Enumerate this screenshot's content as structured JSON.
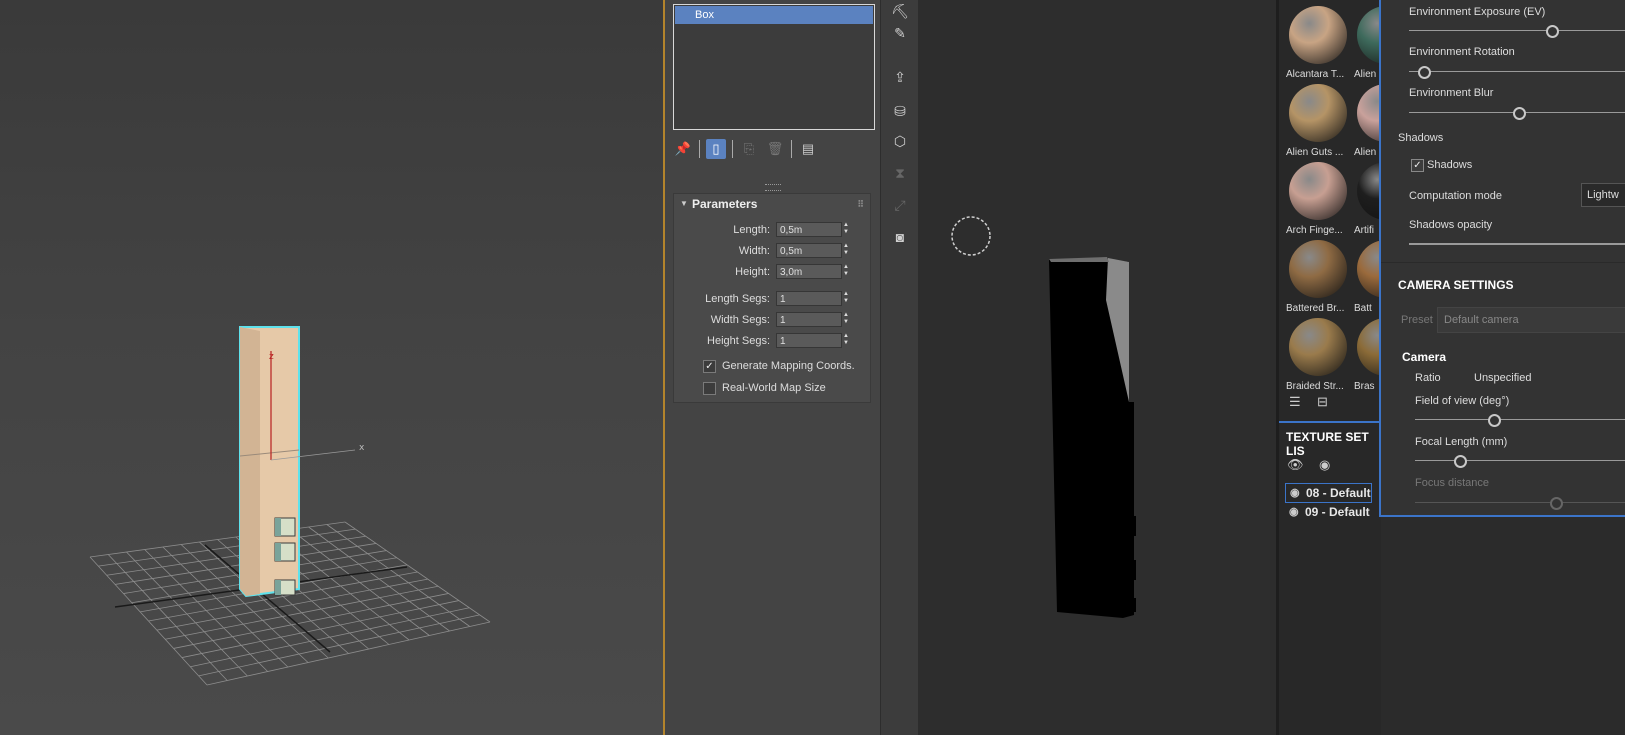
{
  "modifier_stack": {
    "selected_item": "Box"
  },
  "parameters": {
    "title": "Parameters",
    "fields": [
      {
        "label": "Length:",
        "value": "0,5m"
      },
      {
        "label": "Width:",
        "value": "0,5m"
      },
      {
        "label": "Height:",
        "value": "3,0m"
      },
      {
        "label": "Length Segs:",
        "value": "1"
      },
      {
        "label": "Width Segs:",
        "value": "1"
      },
      {
        "label": "Height Segs:",
        "value": "1"
      }
    ],
    "checkboxes": [
      {
        "label": "Generate Mapping Coords.",
        "checked": true,
        "mark": "✓"
      },
      {
        "label": "Real-World Map Size",
        "checked": false,
        "mark": ""
      }
    ]
  },
  "viewport_axes": {
    "z": "z",
    "x": "x"
  },
  "shelf": {
    "materials": [
      {
        "label": "Alcantara T...",
        "color": "#c8a484"
      },
      {
        "label": "Alien",
        "color": "#3e6a5c"
      },
      {
        "label": "Alien Guts ...",
        "color": "#b59466"
      },
      {
        "label": "Alien",
        "color": "#c9a19b"
      },
      {
        "label": "Arch Finge...",
        "color": "#c79f92"
      },
      {
        "label": "Artifi",
        "color": "#1e1e1e"
      },
      {
        "label": "Battered Br...",
        "color": "#8f6b44"
      },
      {
        "label": "Batt",
        "color": "#9a6a3c"
      },
      {
        "label": "Braided Str...",
        "color": "#9a7b4c"
      },
      {
        "label": "Bras",
        "color": "#8b6b38"
      }
    ]
  },
  "texture_set_list": {
    "title": "TEXTURE SET LIS",
    "items": [
      "08 - Default",
      "09 - Default"
    ]
  },
  "display_settings": {
    "env_exposure_label": "Environment Exposure (EV)",
    "env_exposure_value": 0.65,
    "env_rotation_label": "Environment Rotation",
    "env_rotation_value": 0.07,
    "env_blur_label": "Environment Blur",
    "env_blur_value": 0.5,
    "shadows_section": "Shadows",
    "shadows_checkbox_label": "Shadows",
    "shadows_checked": true,
    "shadows_mark": "✓",
    "computation_mode_label": "Computation mode",
    "computation_mode_value": "Lightw",
    "shadows_opacity_label": "Shadows opacity",
    "camera_settings_title": "CAMERA SETTINGS",
    "preset_label": "Preset",
    "preset_value": "Default camera",
    "camera_title": "Camera",
    "ratio_label": "Ratio",
    "ratio_value": "Unspecified",
    "fov_label": "Field of view (deg°)",
    "fov_value": 0.37,
    "focal_length_label": "Focal Length (mm)",
    "focal_length_value": 0.21,
    "focus_distance_label": "Focus distance",
    "focus_distance_value": 0.66
  }
}
